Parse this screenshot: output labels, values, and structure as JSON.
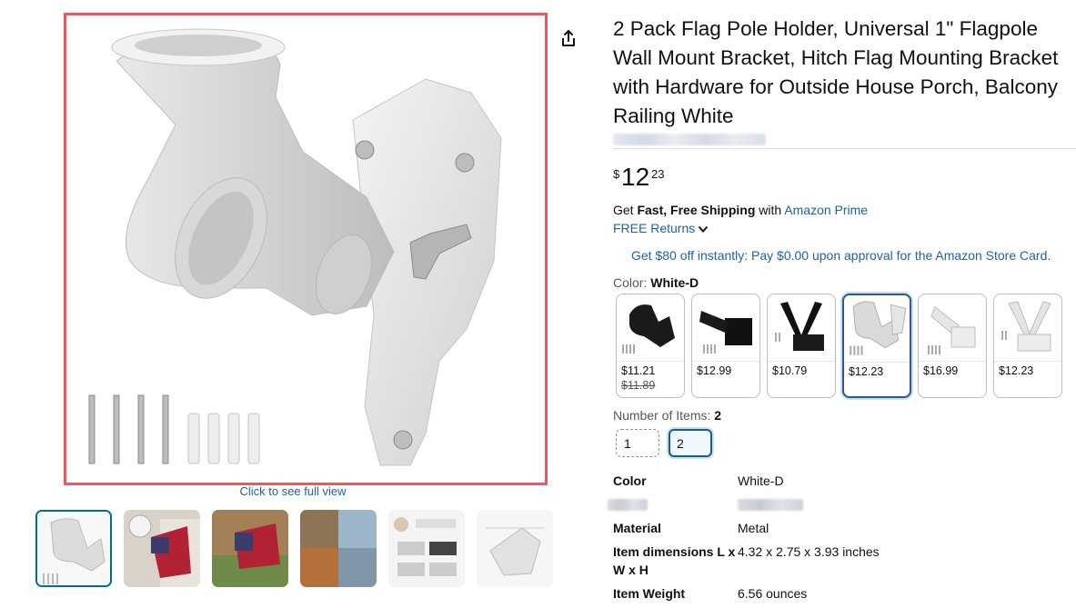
{
  "product": {
    "title": "2 Pack Flag Pole Holder, Universal 1\" Flagpole Wall Mount Bracket, Hitch Flag Mounting Bracket with Hardware for Outside House Porch, Balcony Railing White",
    "price_symbol": "$",
    "price_whole": "12",
    "price_fraction": "23"
  },
  "gallery": {
    "click_full_view": "Click to see full view",
    "thumbnail_count": 6,
    "selected_index": 0
  },
  "shipping": {
    "prefix": "Get ",
    "bold": "Fast, Free Shipping",
    "middle": " with ",
    "prime_link": "Amazon Prime",
    "returns": "FREE Returns"
  },
  "promo": "Get $80 off instantly: Pay $0.00 upon approval for the Amazon Store Card.",
  "color": {
    "label": "Color: ",
    "selected": "White-D",
    "options": [
      {
        "price": "$11.21",
        "old_price": "$11.89",
        "theme": "black"
      },
      {
        "price": "$12.99",
        "old_price": "",
        "theme": "black"
      },
      {
        "price": "$10.79",
        "old_price": "",
        "theme": "black"
      },
      {
        "price": "$12.23",
        "old_price": "",
        "theme": "white",
        "selected": true
      },
      {
        "price": "$16.99",
        "old_price": "",
        "theme": "white"
      },
      {
        "price": "$12.23",
        "old_price": "",
        "theme": "white"
      }
    ]
  },
  "items": {
    "label": "Number of Items: ",
    "selected": "2",
    "options": [
      "1",
      "2"
    ]
  },
  "specs": [
    {
      "label": "Color",
      "value": "White-D"
    },
    {
      "label": "Material",
      "value": "Metal"
    },
    {
      "label": "Item dimensions L x",
      "label2": "W x H",
      "value": "4.32 x 2.75 x 3.93 inches"
    },
    {
      "label": "Item Weight",
      "value": "6.56 ounces"
    }
  ],
  "colors": {
    "link": "#2162a1",
    "selected_border": "#2a5b84",
    "image_frame": "#e85a5f"
  }
}
